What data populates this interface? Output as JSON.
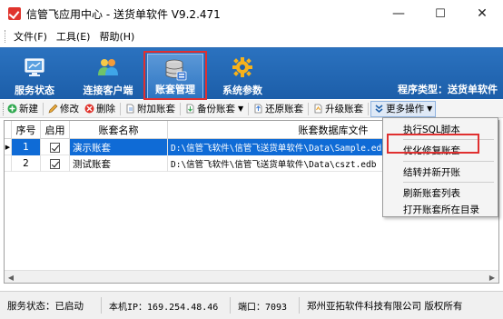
{
  "window": {
    "title": "信管飞应用中心 - 送货单软件 V9.2.471",
    "minimize": "—",
    "maximize": "☐",
    "close": "✕"
  },
  "menu": [
    "文件(F)",
    "工具(E)",
    "帮助(H)"
  ],
  "nav": {
    "items": [
      {
        "label": "服务状态",
        "icon": "monitor-icon"
      },
      {
        "label": "连接客户端",
        "icon": "users-icon"
      },
      {
        "label": "账套管理",
        "icon": "database-icon"
      },
      {
        "label": "系统参数",
        "icon": "gear-icon"
      }
    ],
    "active": "账套管理",
    "program_type": "程序类型：送货单软件"
  },
  "toolbar": {
    "new": "新建",
    "edit": "修改",
    "delete": "删除",
    "attach": "附加账套",
    "backup": "备份账套",
    "restore": "还原账套",
    "upgrade": "升级账套",
    "more": "更多操作"
  },
  "table": {
    "headers": [
      "序号",
      "启用",
      "账套名称",
      "账套数据库文件"
    ],
    "rows": [
      {
        "no": "1",
        "enabled": true,
        "name": "演示账套",
        "file": "D:\\信管飞软件\\信管飞送货单软件\\Data\\Sample.edb",
        "selected": true
      },
      {
        "no": "2",
        "enabled": true,
        "name": "测试账套",
        "file": "D:\\信管飞软件\\信管飞送货单软件\\Data\\cszt.edb",
        "selected": false
      }
    ]
  },
  "dropdown": {
    "items": [
      "执行SQL脚本",
      "优化修复账套",
      "结转并新开账",
      "刷新账套列表",
      "打开账套所在目录"
    ],
    "highlighted": "优化修复账套"
  },
  "status": {
    "service": "服务状态：已启动",
    "ip": "本机IP：169.254.48.46",
    "port": "端口：7093",
    "copyright": "郑州亚拓软件科技有限公司 版权所有"
  },
  "colors": {
    "ribbon": "#1c5ea9",
    "selection": "#0f6bd6",
    "highlight_box": "#e03030"
  }
}
